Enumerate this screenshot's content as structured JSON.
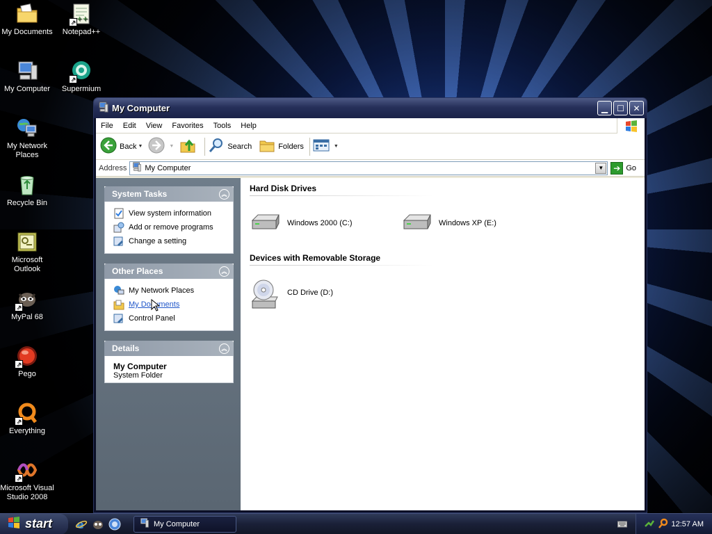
{
  "desktop": {
    "icons": [
      {
        "label": "My Documents",
        "icon": "folder-documents-icon"
      },
      {
        "label": "Notepad++",
        "icon": "notepad-plus-plus-icon"
      },
      {
        "label": "My Computer",
        "icon": "computer-icon"
      },
      {
        "label": "Supermium",
        "icon": "supermium-browser-icon"
      },
      {
        "label": "My Network Places",
        "icon": "network-places-icon"
      },
      {
        "label": "Recycle Bin",
        "icon": "recycle-bin-icon"
      },
      {
        "label": "Microsoft Outlook",
        "icon": "outlook-icon"
      },
      {
        "label": "MyPal 68",
        "icon": "mypal-browser-icon"
      },
      {
        "label": "Pego",
        "icon": "pego-icon"
      },
      {
        "label": "Everything",
        "icon": "everything-search-icon"
      },
      {
        "label": "Microsoft Visual Studio 2008",
        "icon": "visual-studio-icon"
      }
    ]
  },
  "window": {
    "title": "My Computer",
    "menu": [
      "File",
      "Edit",
      "View",
      "Favorites",
      "Tools",
      "Help"
    ],
    "toolbar": {
      "back": "Back",
      "search": "Search",
      "folders": "Folders"
    },
    "address": {
      "label": "Address",
      "value": "My Computer",
      "go": "Go"
    },
    "taskpane": {
      "system_tasks": {
        "title": "System Tasks",
        "links": [
          "View system information",
          "Add or remove programs",
          "Change a setting"
        ]
      },
      "other_places": {
        "title": "Other Places",
        "links": [
          "My Network Places",
          "My Documents",
          "Control Panel"
        ]
      },
      "details": {
        "title": "Details",
        "name": "My Computer",
        "type": "System Folder"
      }
    },
    "groups": {
      "hard_disks": {
        "title": "Hard Disk Drives",
        "items": [
          "Windows 2000 (C:)",
          "Windows XP (E:)"
        ]
      },
      "removable": {
        "title": "Devices with Removable Storage",
        "items": [
          "CD Drive (D:)"
        ]
      }
    }
  },
  "taskbar": {
    "start": "start",
    "task_button": "My Computer",
    "clock": "12:57 AM"
  }
}
